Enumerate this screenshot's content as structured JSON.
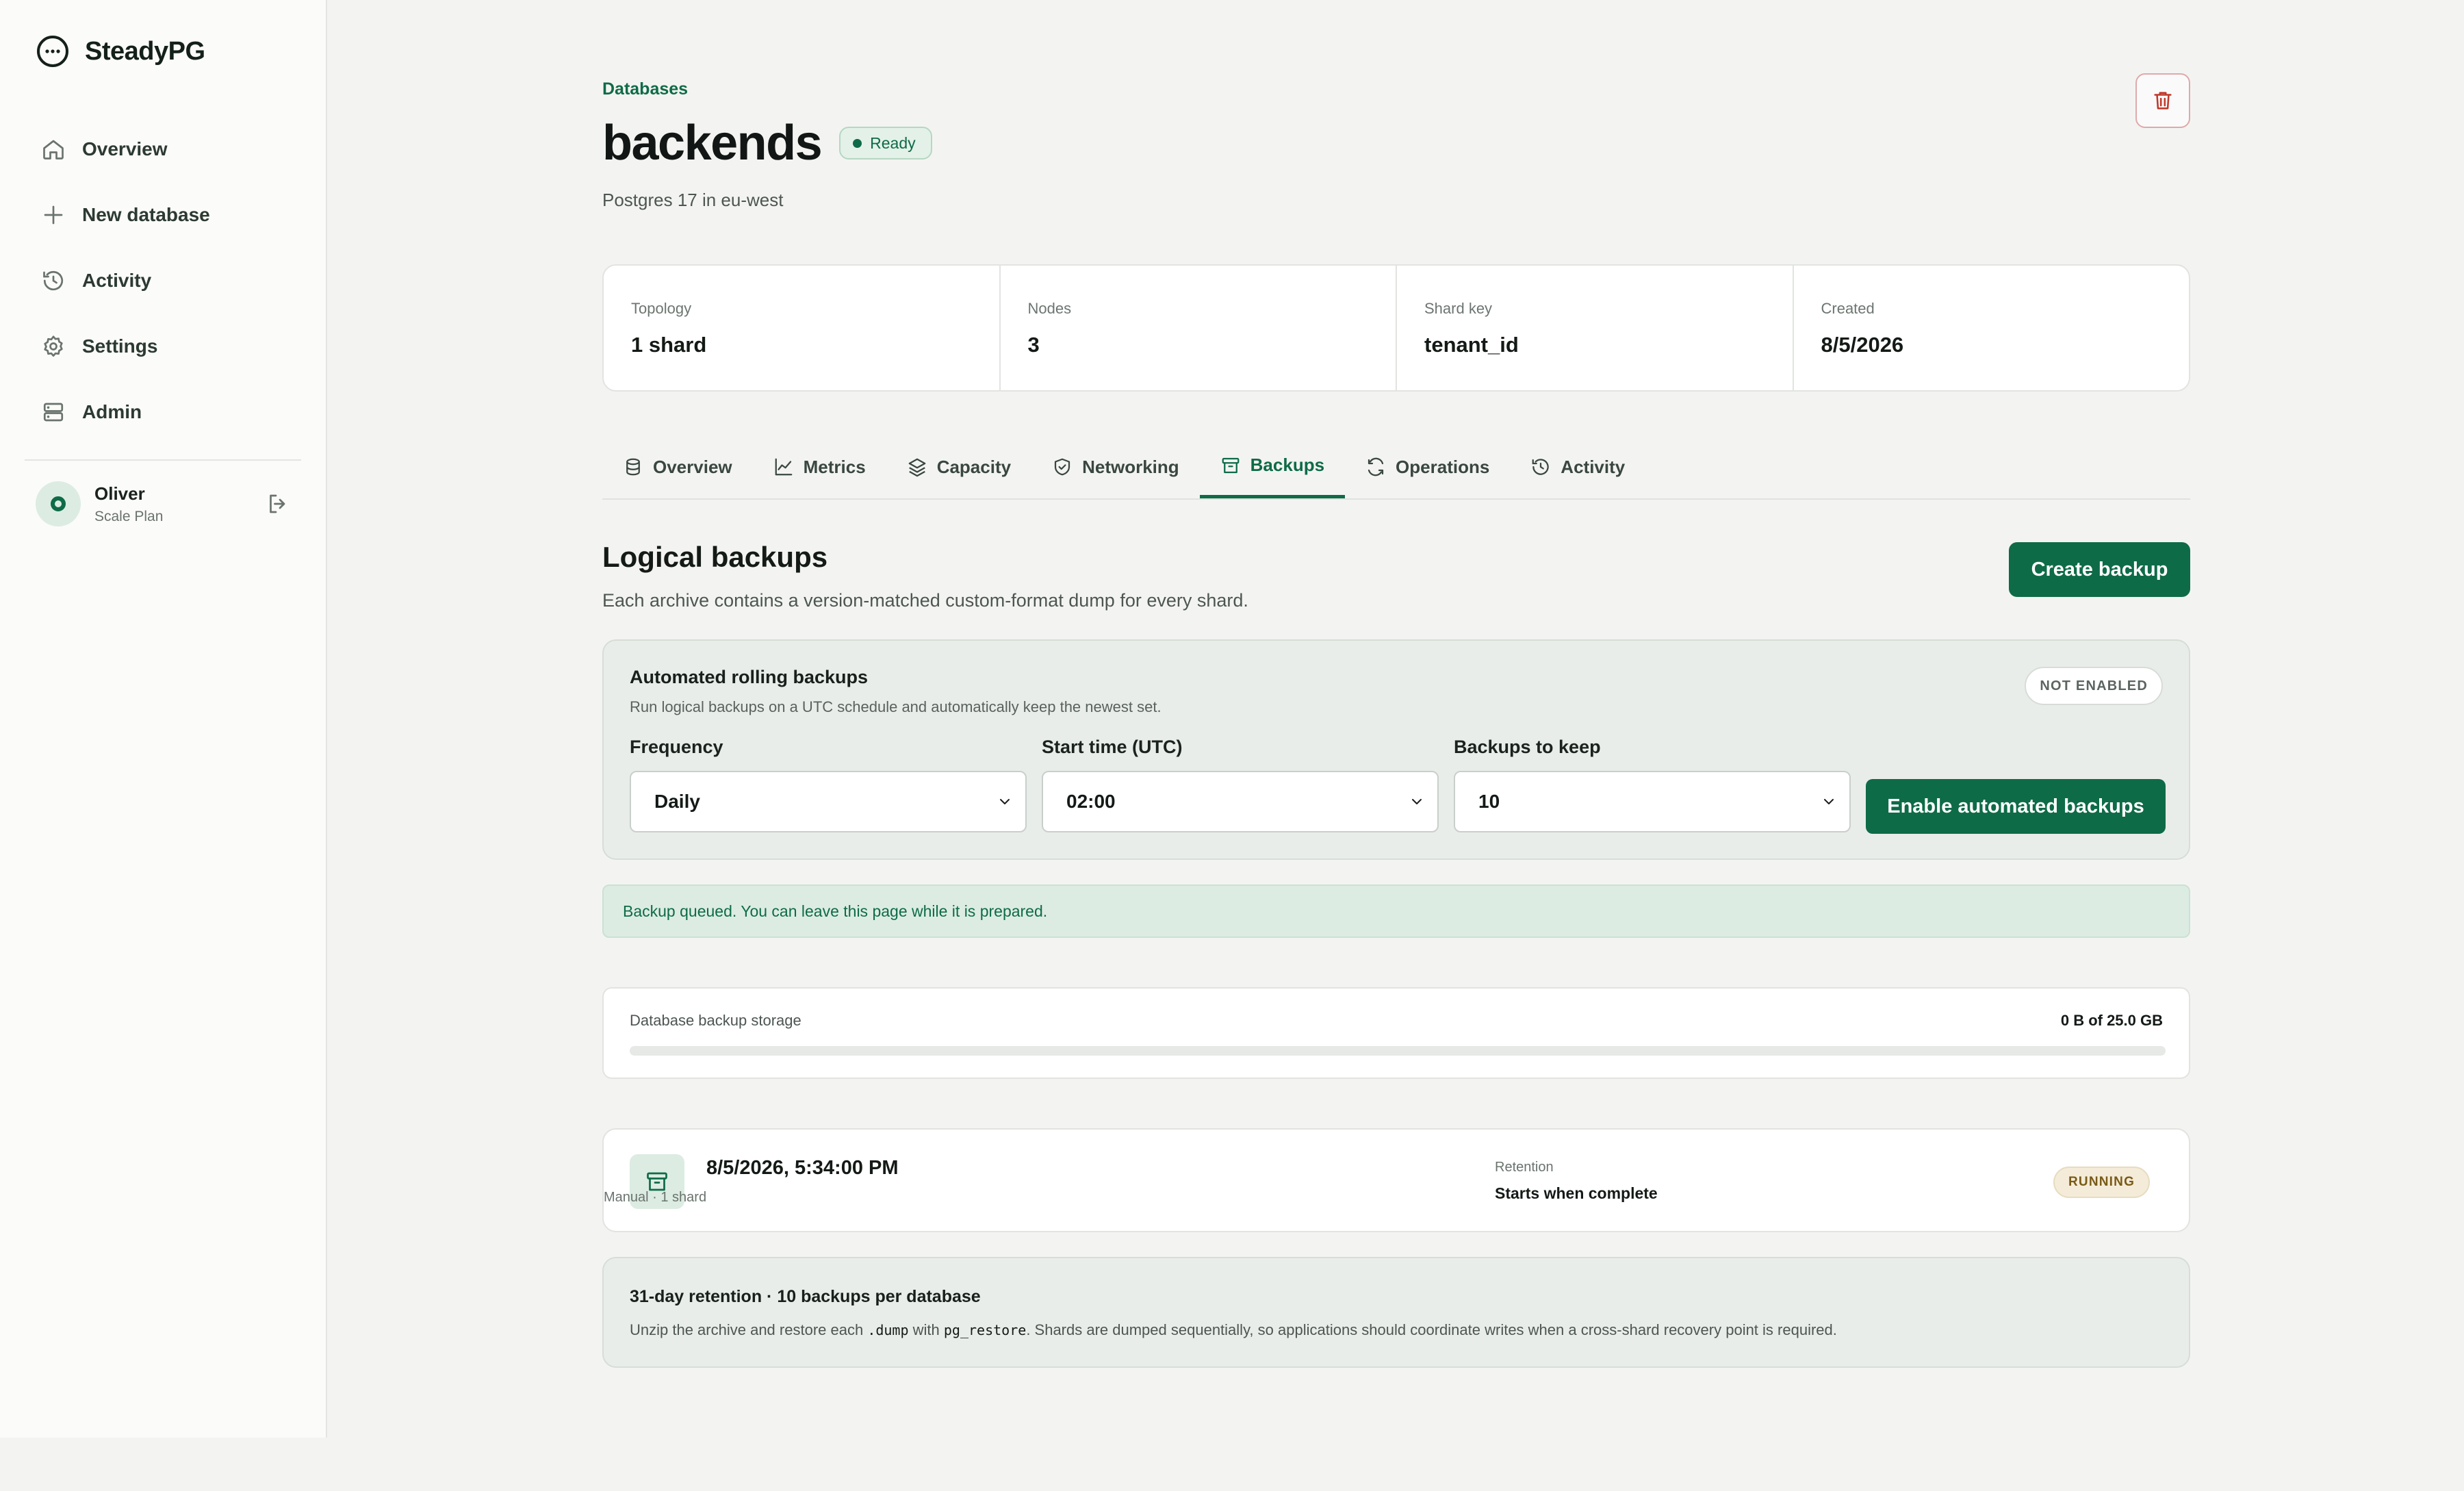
{
  "brand": {
    "name": "SteadyPG"
  },
  "nav": [
    {
      "label": "Overview",
      "icon": "home-icon"
    },
    {
      "label": "New database",
      "icon": "plus-icon"
    },
    {
      "label": "Activity",
      "icon": "history-icon"
    },
    {
      "label": "Settings",
      "icon": "gear-icon"
    },
    {
      "label": "Admin",
      "icon": "server-icon"
    }
  ],
  "user": {
    "name": "Oliver",
    "plan": "Scale Plan"
  },
  "header": {
    "breadcrumb": "Databases",
    "title": "backends",
    "status": "Ready",
    "subtitle": "Postgres 17 in eu-west"
  },
  "stats": [
    {
      "label": "Topology",
      "value": "1 shard"
    },
    {
      "label": "Nodes",
      "value": "3"
    },
    {
      "label": "Shard key",
      "value": "tenant_id"
    },
    {
      "label": "Created",
      "value": "8/5/2026"
    }
  ],
  "tabs": [
    {
      "label": "Overview",
      "icon": "database-icon"
    },
    {
      "label": "Metrics",
      "icon": "chart-line-icon"
    },
    {
      "label": "Capacity",
      "icon": "layers-icon"
    },
    {
      "label": "Networking",
      "icon": "shield-icon"
    },
    {
      "label": "Backups",
      "icon": "archive-icon",
      "active": true
    },
    {
      "label": "Operations",
      "icon": "refresh-icon"
    },
    {
      "label": "Activity",
      "icon": "history-icon"
    }
  ],
  "section": {
    "title": "Logical backups",
    "description": "Each archive contains a version-matched custom-format dump for every shard.",
    "create_label": "Create backup"
  },
  "automated": {
    "title": "Automated rolling backups",
    "description": "Run logical backups on a UTC schedule and automatically keep the newest set.",
    "status": "NOT ENABLED",
    "frequency_label": "Frequency",
    "frequency_value": "Daily",
    "start_label": "Start time (UTC)",
    "start_value": "02:00",
    "keep_label": "Backups to keep",
    "keep_value": "10",
    "enable_label": "Enable automated backups"
  },
  "banner": {
    "text": "Backup queued. You can leave this page while it is prepared."
  },
  "storage": {
    "label": "Database backup storage",
    "value": "0 B of 25.0 GB",
    "used_fraction": 0
  },
  "backup": {
    "time": "8/5/2026, 5:34:00 PM",
    "meta": "Manual · 1 shard",
    "retention_label": "Retention",
    "retention_value": "Starts when complete",
    "status": "RUNNING"
  },
  "info": {
    "title": "31-day retention · 10 backups per database",
    "text_1": "Unzip the archive and restore each ",
    "code_1": ".dump",
    "text_2": " with ",
    "code_2": "pg_restore",
    "text_3": ". Shards are dumped sequentially, so applications should coordinate writes when a cross-shard recovery point is required."
  },
  "colors": {
    "accent": "#0e6b47",
    "danger": "#c0392b",
    "running": "#7a5a16"
  }
}
